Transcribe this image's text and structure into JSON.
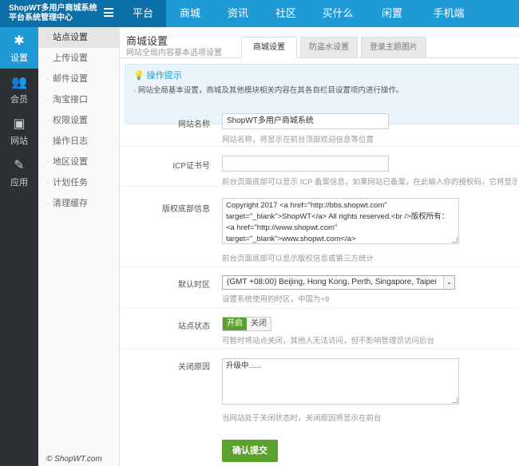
{
  "brand": {
    "line1": "ShopWT多用户商城系统",
    "line2": "平台系统管理中心"
  },
  "nav": [
    {
      "label": "平台",
      "active": true
    },
    {
      "label": "商城"
    },
    {
      "label": "资讯"
    },
    {
      "label": "社区"
    },
    {
      "label": "买什么"
    },
    {
      "label": "闲置"
    },
    {
      "label": "手机端"
    }
  ],
  "iconbar": [
    {
      "label": "设置",
      "icon": "gear-icon",
      "active": true
    },
    {
      "label": "会员",
      "icon": "users-icon"
    },
    {
      "label": "网站",
      "icon": "sitemap-icon"
    },
    {
      "label": "应用",
      "icon": "app-icon"
    }
  ],
  "submenu": [
    "站点设置",
    "上传设置",
    "邮件设置",
    "淘宝接口",
    "权限设置",
    "操作日志",
    "地区设置",
    "计划任务",
    "清理缓存"
  ],
  "copyright": "© ShopWT.com",
  "header": {
    "title": "商城设置",
    "subtitle": "网站全局内容基本选项设置"
  },
  "tabs": [
    "商城设置",
    "防盗水设置",
    "登录主题图片"
  ],
  "tips": {
    "title": "操作提示",
    "text": "网站全局基本设置，商城及其他模块相关内容在其各自栏目设置项内进行操作。"
  },
  "form": {
    "site_name": {
      "label": "网站名称",
      "value": "ShopWT多用户商城系统",
      "hint": "网站名称，将显示在前台顶部欢迎信息等位置"
    },
    "icp": {
      "label": "ICP证书号",
      "value": "",
      "hint": "前台页面底部可以显示 ICP 备案信息，如果网站已备案，在此输入你的授权码，它将显示在前台页"
    },
    "copyright_info": {
      "label": "版权底部信息",
      "lines": [
        "Copyright 2017 <a href=\"http://bbs.shopwt.com\"",
        "target=\"_blank\">ShopWT</a> All rights reserved.<br />版权所有：",
        "<a href=\"http://www.shopwt.com\"",
        "target=\"_blank\">www.shopwt.com</a>"
      ],
      "hint": "前台页面底部可以显示版权信息或第三方统计"
    },
    "timezone": {
      "label": "默认时区",
      "value": "(GMT +08:00) Beijing, Hong Kong, Perth, Singapore, Taipei",
      "hint": "设置系统使用的时区，中国为+8"
    },
    "status": {
      "label": "站点状态",
      "on": "开启",
      "off": "关闭",
      "hint": "可暂时将站点关闭，其他人无法访问，但不影响管理员访问后台"
    },
    "close_reason": {
      "label": "关闭原因",
      "value": "升级中......",
      "hint": "当网站处于关闭状态时，关闭原因将显示在前台"
    },
    "submit": "确认提交"
  },
  "colors": {
    "topbar": "#1e9bd7",
    "brand_bg": "#0d6fa8",
    "accent_green": "#5ba12e",
    "dark_sidebar": "#2c2f33"
  }
}
